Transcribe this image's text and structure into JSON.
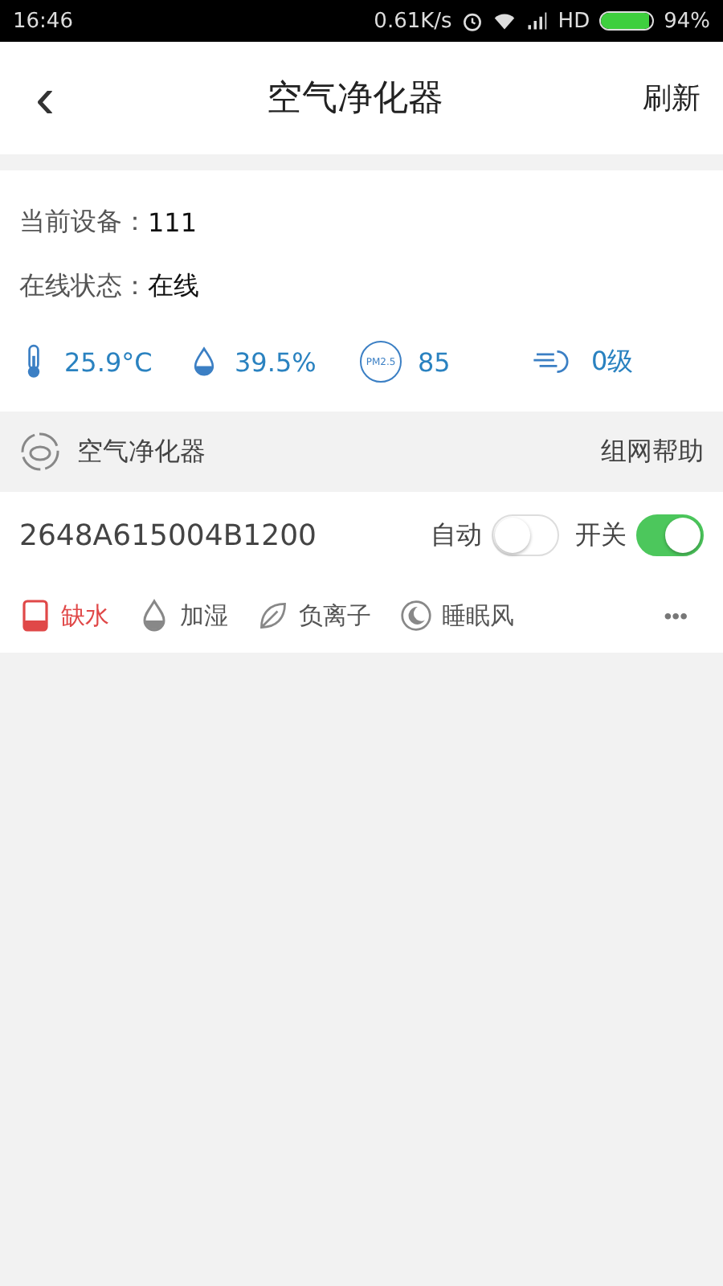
{
  "status_bar": {
    "time": "16:46",
    "speed": "0.61K/s",
    "network": "HD",
    "battery": "94%",
    "level": 0.94
  },
  "header": {
    "back": "‹",
    "title": "空气净化器",
    "action": "刷新"
  },
  "info": [
    {
      "label": "当前设备：",
      "value": "111"
    },
    {
      "label": "在线状态：",
      "value": "在线"
    }
  ],
  "sensors": [
    {
      "kind": "temperature",
      "value": "25.9°C"
    },
    {
      "kind": "humidity",
      "value": "39.5%"
    },
    {
      "kind": "pm25",
      "icon_label": "PM2.5",
      "value": "85"
    },
    {
      "kind": "wind",
      "value": "0级"
    }
  ],
  "section": {
    "title": "空气净化器",
    "help": "组网帮助"
  },
  "device": {
    "id": "2648A615004B1200",
    "toggles": [
      {
        "label": "自动",
        "on": false
      },
      {
        "label": "开关",
        "on": true
      }
    ]
  },
  "features": [
    {
      "kind": "water",
      "label": "缺水",
      "alert": true
    },
    {
      "kind": "humidify",
      "label": "加湿",
      "alert": false
    },
    {
      "kind": "ion",
      "label": "负离子",
      "alert": false
    },
    {
      "kind": "sleep",
      "label": "睡眠风",
      "alert": false
    }
  ],
  "more": "•••"
}
